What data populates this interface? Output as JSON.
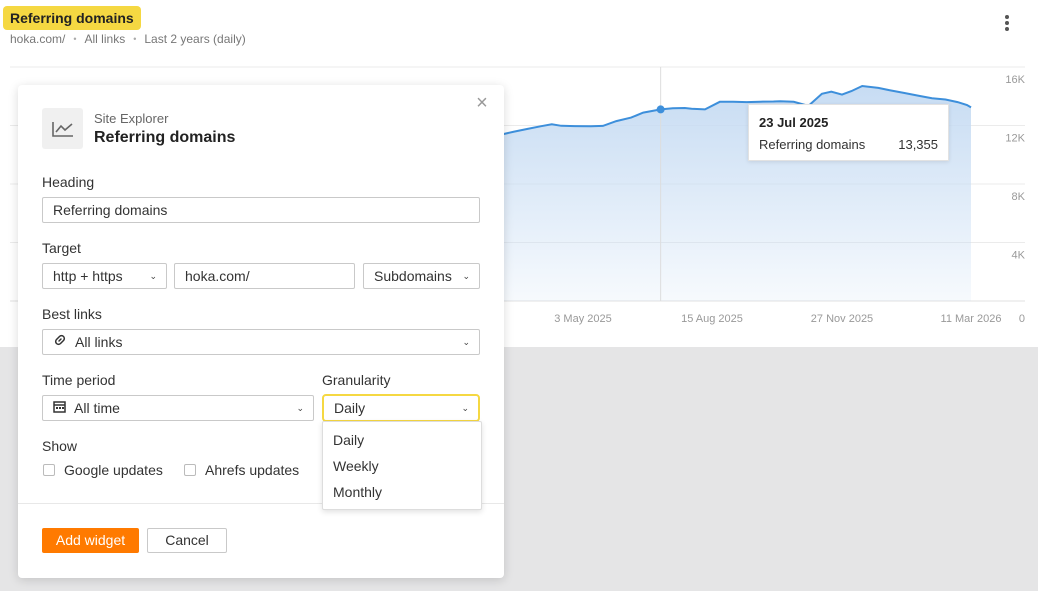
{
  "widget": {
    "title": "Referring domains",
    "subtitle": {
      "target": "hoka.com/",
      "links": "All links",
      "period": "Last 2 years (daily)"
    },
    "more_icon": "more-vertical-icon"
  },
  "chart_data": {
    "type": "area",
    "series": [
      {
        "x": [
          "2025-03-15",
          "2025-03-25",
          "2025-04-05",
          "2025-04-15",
          "2025-04-25",
          "2025-05-03",
          "2025-05-10",
          "2025-05-20",
          "2025-06-01",
          "2025-06-10",
          "2025-06-20",
          "2025-07-01",
          "2025-07-10",
          "2025-07-23",
          "2025-08-01",
          "2025-08-10",
          "2025-08-15",
          "2025-08-25",
          "2025-09-05",
          "2025-09-15",
          "2025-09-25",
          "2025-10-05",
          "2025-10-15",
          "2025-10-20",
          "2025-10-30",
          "2025-11-10",
          "2025-11-20",
          "2025-11-27",
          "2025-12-05",
          "2025-12-12",
          "2025-12-20",
          "2026-01-01",
          "2026-01-10",
          "2026-01-20",
          "2026-02-01",
          "2026-02-10",
          "2026-02-20",
          "2026-03-01",
          "2026-03-08",
          "2026-03-11"
        ],
        "values": [
          11140,
          11350,
          11580,
          11770,
          11950,
          12080,
          11980,
          11960,
          11950,
          11970,
          12300,
          12540,
          12880,
          13100,
          13180,
          13200,
          13140,
          13100,
          13620,
          13620,
          13600,
          13630,
          13640,
          13660,
          13620,
          13340,
          14170,
          14310,
          14110,
          14350,
          14700,
          14570,
          14400,
          14230,
          14020,
          13870,
          13780,
          13600,
          13400,
          13240
        ]
      }
    ],
    "x_ticks": [
      "3 May 2025",
      "15 Aug 2025",
      "27 Nov 2025",
      "11 Mar 2026"
    ],
    "y_ticks": [
      "0",
      "4K",
      "8K",
      "12K",
      "16K"
    ],
    "ylim": [
      0,
      16000
    ],
    "grid": true,
    "colors": {
      "line": "#3d8fdb",
      "fill": "#c7dcf3"
    },
    "tooltip": {
      "date": "23 Jul 2025",
      "series": "Referring domains",
      "value": "13,355"
    }
  },
  "modal": {
    "app": "Site Explorer",
    "title": "Referring domains",
    "icon": "line-chart-icon",
    "close_icon": "close-icon",
    "heading_label": "Heading",
    "heading_value": "Referring domains",
    "target_label": "Target",
    "protocol": "http + https",
    "target_value": "hoka.com/",
    "mode": "Subdomains",
    "best_links_label": "Best links",
    "best_links_value": "All links",
    "time_period_label": "Time period",
    "time_period_value": "All time",
    "granularity_label": "Granularity",
    "granularity_value": "Daily",
    "granularity_options": [
      "Daily",
      "Weekly",
      "Monthly"
    ],
    "show_label": "Show",
    "google_updates": "Google updates",
    "ahrefs_updates": "Ahrefs updates",
    "add_button": "Add widget",
    "cancel_button": "Cancel",
    "accent": "#ff7a00",
    "highlight": "#f5d842"
  }
}
